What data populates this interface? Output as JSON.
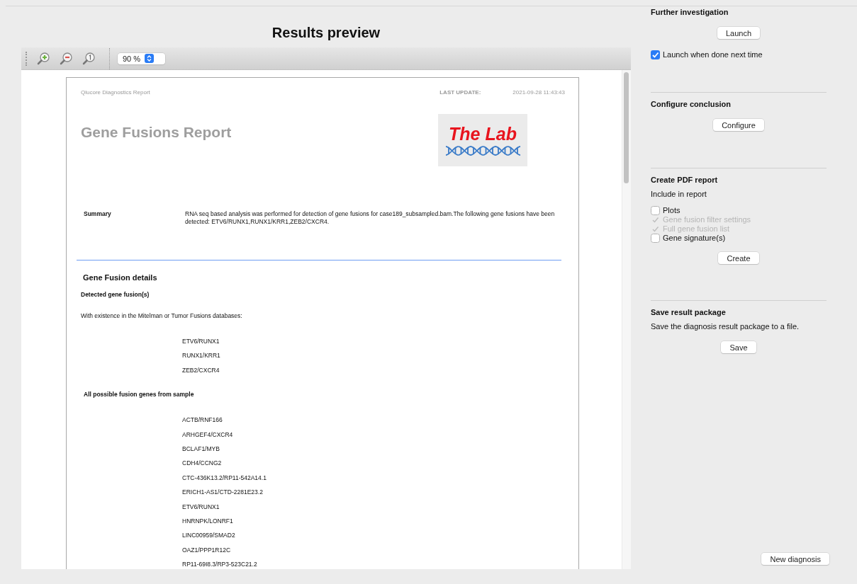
{
  "title": "Results preview",
  "toolbar": {
    "zoom": "90 %"
  },
  "report": {
    "header_left": "Qlucore Diagnostics Report",
    "last_update_label": "LAST UPDATE:",
    "last_update": "2021-09-28 11:43:43",
    "title": "Gene Fusions Report",
    "logo_text": "The Lab",
    "summary": {
      "label": "Summary",
      "text": "RNA seq based analysis was performed for detection of gene fusions for case189_subsampled.bam.The following gene fusions have been detected: ETV6/RUNX1,RUNX1/KRR1,ZEB2/CXCR4."
    },
    "details_heading": "Gene Fusion details",
    "blocks": [
      {
        "kind": "subheading",
        "text": "Detected gene fusion(s)"
      },
      {
        "kind": "paragraph",
        "text": "With existence in the Mitelman or Tumor Fusions databases:"
      },
      {
        "kind": "list",
        "items": [
          "ETV6/RUNX1",
          "RUNX1/KRR1",
          "ZEB2/CXCR4"
        ]
      },
      {
        "kind": "subheading",
        "text": "All possible fusion genes from sample"
      },
      {
        "kind": "list",
        "items": [
          "ACTB/RNF166",
          "ARHGEF4/CXCR4",
          "BCLAF1/MYB",
          "CDH4/CCNG2",
          "CTC-436K13.2/RP11-542A14.1",
          "ERICH1-AS1/CTD-2281E23.2",
          "ETV6/RUNX1",
          "HNRNPK/LONRF1",
          "LINC00959/SMAD2",
          "OAZ1/PPP1R12C",
          "RP11-69I8.3/RP3-523C21.2"
        ]
      }
    ]
  },
  "sections": [
    {
      "heading": "Further investigation",
      "items": [
        {
          "kind": "button",
          "label": "Launch"
        },
        {
          "kind": "checkbox",
          "label": "Launch when done next time",
          "checked": true,
          "disabled": false
        }
      ]
    },
    {
      "heading": "Configure conclusion",
      "items": [
        {
          "kind": "button",
          "label": "Configure"
        }
      ]
    },
    {
      "heading": "Create PDF report",
      "items": [
        {
          "kind": "text",
          "text": "Include in report"
        },
        {
          "kind": "checkbox",
          "label": "Plots",
          "checked": false,
          "disabled": false
        },
        {
          "kind": "checkbox",
          "label": "Gene fusion filter settings",
          "checked": true,
          "disabled": true
        },
        {
          "kind": "checkbox",
          "label": "Full gene fusion list",
          "checked": true,
          "disabled": true
        },
        {
          "kind": "checkbox",
          "label": "Gene signature(s)",
          "checked": false,
          "disabled": false
        },
        {
          "kind": "button",
          "label": "Create"
        }
      ]
    },
    {
      "heading": "Save result package",
      "items": [
        {
          "kind": "text",
          "text": "Save the diagnosis result package to a file."
        },
        {
          "kind": "button",
          "label": "Save"
        }
      ]
    }
  ],
  "new_diagnosis": "New diagnosis"
}
